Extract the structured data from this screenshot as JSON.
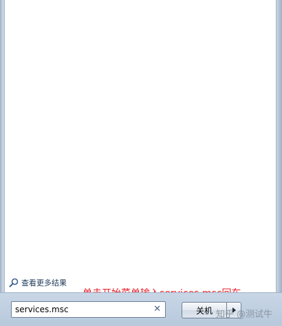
{
  "start_menu": {
    "more_results_label": "查看更多结果",
    "search": {
      "value": "services.msc",
      "clear_symbol": "✕"
    },
    "shutdown": {
      "label": "关机"
    }
  },
  "annotation": "单击开始菜单输入services.msc回车",
  "watermark": "知乎 @测试牛",
  "colors": {
    "annotation": "#e8202a",
    "link": "#1e395b"
  },
  "icons": {
    "more_results": "search-icon",
    "shutdown_arrow": "triangle-right-icon"
  }
}
